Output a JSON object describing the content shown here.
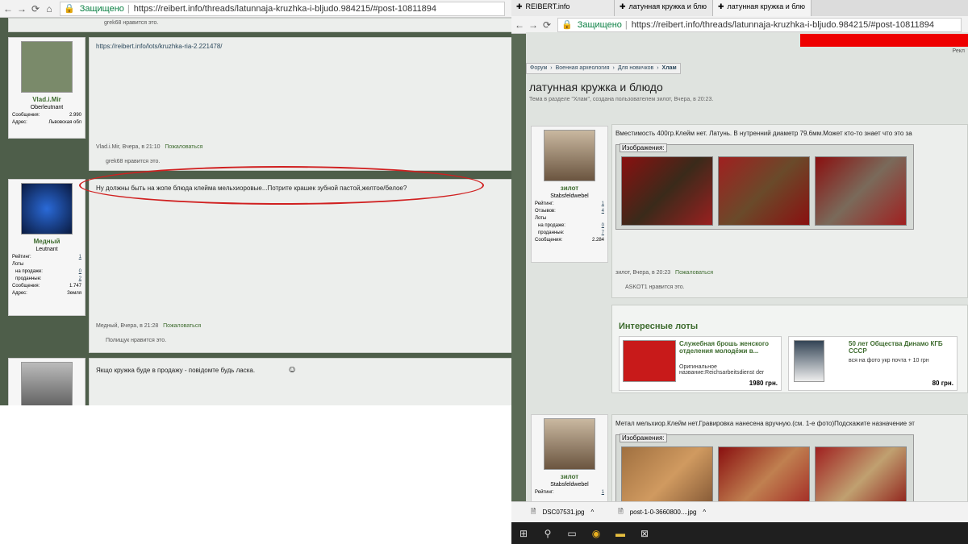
{
  "left": {
    "url": "https://reibert.info/threads/latunnaja-kruzhka-i-bljudo.984215/#post-10811894",
    "secure": "Защищено",
    "top_like": "grek68 нравится это.",
    "post1": {
      "text": "https://reibert.info/lots/kruzhka-ria-2.221478/",
      "user": "Vlad.i.Mir",
      "title": "Oberleutnant",
      "stats": [
        [
          "Сообщения:",
          "2.990"
        ],
        [
          "Адрес:",
          "Львовская обл"
        ]
      ],
      "meta": "Vlad.i.Mir, Вчера, в 21:10",
      "report": "Пожаловаться",
      "like": "grek68 нравится это."
    },
    "post2": {
      "text": "Ну должны быть на жопе блюда клейма мельхиоровые...Потрите крашек зубной пастой,желтое/белое?",
      "user": "Медный",
      "title": "Leutnant",
      "stats": [
        [
          "Рейтинг:",
          "1"
        ],
        [
          "Лоты",
          ""
        ],
        [
          "на продажe:",
          "0"
        ],
        [
          "проданные:",
          "2"
        ],
        [
          "Сообщения:",
          "1.747"
        ],
        [
          "Адрес:",
          "Земля"
        ]
      ],
      "meta": "Медный, Вчера, в 21:28",
      "report": "Пожаловаться",
      "like": "Полищук нравится это."
    },
    "post3": {
      "text": "Якщо кружка буде в продажу - повідомте будь ласка."
    }
  },
  "right": {
    "tabs": [
      "REIBERT.info",
      "латунная кружка и блю",
      "латунная кружка и блю"
    ],
    "url": "https://reibert.info/threads/latunnaja-kruzhka-i-bljudo.984215/#post-10811894",
    "secure": "Защищено",
    "ad": "Рекл",
    "crumbs": [
      "Форум",
      "Военная археология",
      "Для новичков",
      "Хлам"
    ],
    "thread_title": "латунная кружка и блюдо",
    "thread_sub": "Тема в разделе \"Хлам\", создана пользователем зилот, Вчера, в 20:23.",
    "post1": {
      "text": "Вместимость 400гр.Клейм нет. Латунь. В нутренний диаметр 79.6мм.Может кто-то знает что это за",
      "images_label": "Изображения:",
      "user": "зилот",
      "title": "Stabsfeldwebel",
      "stats": [
        [
          "Рейтинг:",
          "1"
        ],
        [
          "Отзывов:",
          "4"
        ],
        [
          "Лоты",
          ""
        ],
        [
          "на продаже:",
          "0"
        ],
        [
          "проданные:",
          "7"
        ],
        [
          "Сообщения:",
          "2.284"
        ]
      ],
      "meta": "зилот, Вчера, в 20:23",
      "report": "Пожаловаться",
      "like": "ASKOT1 нравится это."
    },
    "lots": {
      "heading": "Интересные лоты",
      "items": [
        {
          "title": "Служебная брошь женского отделения молодёжи в...",
          "desc": "Оригинальное название:Reichsarbeitsdienst der",
          "price": "1980 грн."
        },
        {
          "title": "50 лет Общества Динамо КГБ СССР",
          "desc": "вся на фото укр почта + 10 грн",
          "price": "80 грн."
        }
      ]
    },
    "post2": {
      "text": "Метал мельхиор.Клейм нет.Гравировка нанесена вручную.(см. 1-е фото)Подскажите назначение эт",
      "images_label": "Изображения:",
      "user": "зилот",
      "title": "Stabsfeldwebel",
      "stat": [
        "Рейтинг:",
        "1"
      ]
    },
    "downloads": [
      "DSC07531.jpg",
      "post-1-0-3660800....jpg"
    ]
  }
}
